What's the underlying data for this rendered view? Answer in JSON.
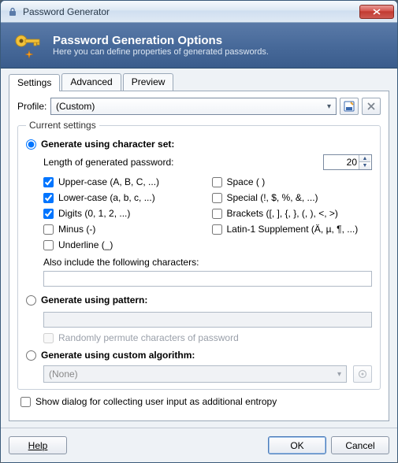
{
  "window": {
    "title": "Password Generator"
  },
  "banner": {
    "title": "Password Generation Options",
    "subtitle": "Here you can define properties of generated passwords."
  },
  "tabs": {
    "settings": "Settings",
    "advanced": "Advanced",
    "preview": "Preview"
  },
  "profile": {
    "label": "Profile:",
    "value": "(Custom)"
  },
  "fieldset_legend": "Current settings",
  "modes": {
    "charset": "Generate using character set:",
    "pattern": "Generate using pattern:",
    "algorithm": "Generate using custom algorithm:"
  },
  "length": {
    "label": "Length of generated password:",
    "value": "20"
  },
  "checks": {
    "upper": {
      "label": "Upper-case (A, B, C, ...)",
      "checked": true
    },
    "space": {
      "label": "Space ( )",
      "checked": false
    },
    "lower": {
      "label": "Lower-case (a, b, c, ...)",
      "checked": true
    },
    "special": {
      "label": "Special (!, $, %, &, ...)",
      "checked": false
    },
    "digits": {
      "label": "Digits (0, 1, 2, ...)",
      "checked": true
    },
    "brackets": {
      "label": "Brackets ([, ], {, }, (, ), <, >)",
      "checked": false
    },
    "minus": {
      "label": "Minus (-)",
      "checked": false
    },
    "latin1": {
      "label": "Latin-1 Supplement (Ä, µ, ¶, ...)",
      "checked": false
    },
    "underline": {
      "label": "Underline (_)",
      "checked": false
    }
  },
  "also_include_label": "Also include the following characters:",
  "permute_label": "Randomly permute characters of password",
  "algorithm_value": "(None)",
  "entropy_label": "Show dialog for collecting user input as additional entropy",
  "buttons": {
    "help": "Help",
    "ok": "OK",
    "cancel": "Cancel"
  }
}
